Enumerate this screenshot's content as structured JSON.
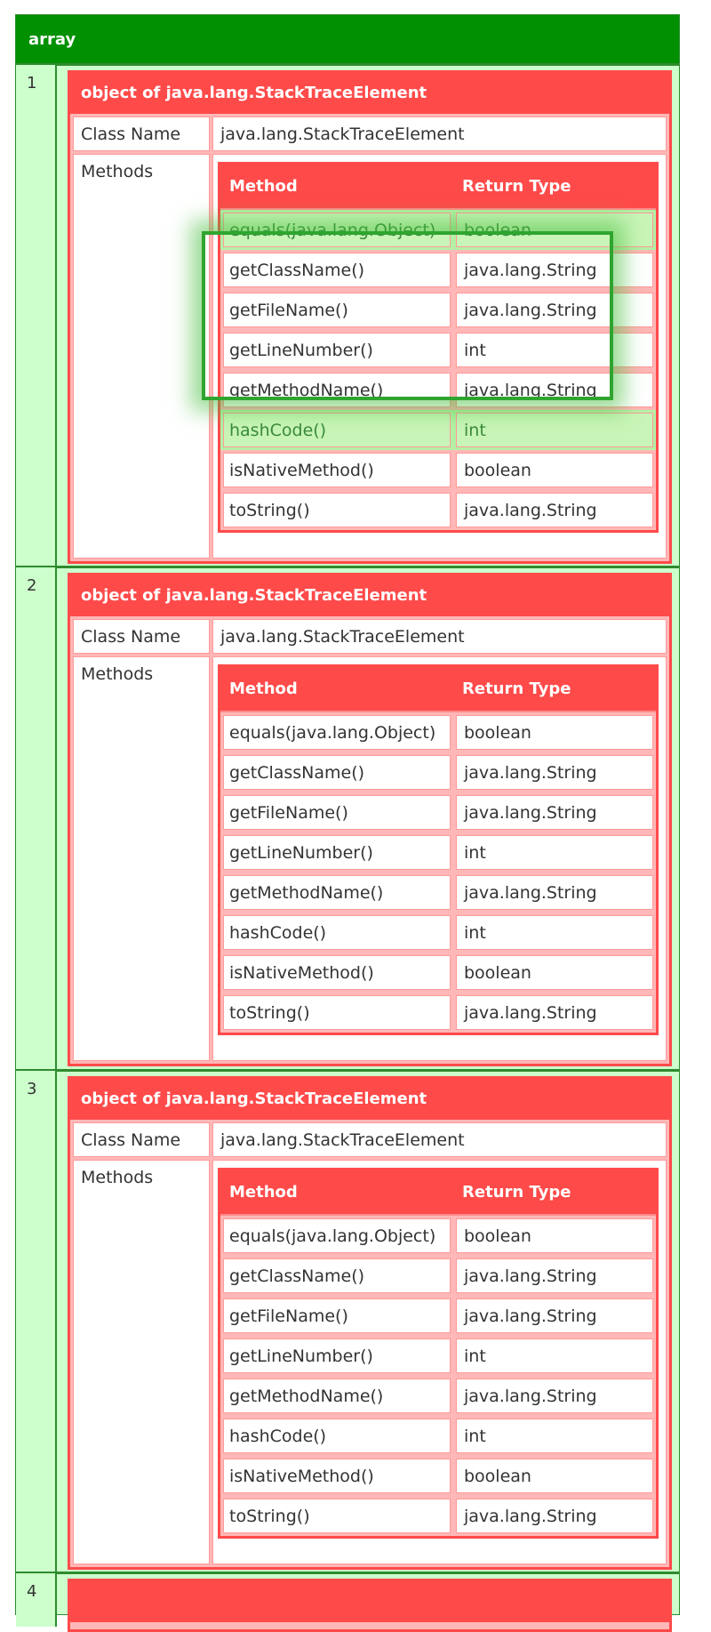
{
  "array": {
    "title": "array",
    "rows": [
      {
        "index": "1",
        "object": {
          "title": "object of java.lang.StackTraceElement",
          "class_name_label": "Class Name",
          "class_name_value": "java.lang.StackTraceElement",
          "methods_label": "Methods",
          "methods_header": {
            "method": "Method",
            "return_type": "Return Type"
          },
          "methods": [
            {
              "name": "equals(java.lang.Object)",
              "return_type": "boolean"
            },
            {
              "name": "getClassName()",
              "return_type": "java.lang.String"
            },
            {
              "name": "getFileName()",
              "return_type": "java.lang.String"
            },
            {
              "name": "getLineNumber()",
              "return_type": "int"
            },
            {
              "name": "getMethodName()",
              "return_type": "java.lang.String"
            },
            {
              "name": "hashCode()",
              "return_type": "int"
            },
            {
              "name": "isNativeMethod()",
              "return_type": "boolean"
            },
            {
              "name": "toString()",
              "return_type": "java.lang.String"
            }
          ]
        }
      },
      {
        "index": "2",
        "object": {
          "title": "object of java.lang.StackTraceElement",
          "class_name_label": "Class Name",
          "class_name_value": "java.lang.StackTraceElement",
          "methods_label": "Methods",
          "methods_header": {
            "method": "Method",
            "return_type": "Return Type"
          },
          "methods": [
            {
              "name": "equals(java.lang.Object)",
              "return_type": "boolean"
            },
            {
              "name": "getClassName()",
              "return_type": "java.lang.String"
            },
            {
              "name": "getFileName()",
              "return_type": "java.lang.String"
            },
            {
              "name": "getLineNumber()",
              "return_type": "int"
            },
            {
              "name": "getMethodName()",
              "return_type": "java.lang.String"
            },
            {
              "name": "hashCode()",
              "return_type": "int"
            },
            {
              "name": "isNativeMethod()",
              "return_type": "boolean"
            },
            {
              "name": "toString()",
              "return_type": "java.lang.String"
            }
          ]
        }
      },
      {
        "index": "3",
        "object": {
          "title": "object of java.lang.StackTraceElement",
          "class_name_label": "Class Name",
          "class_name_value": "java.lang.StackTraceElement",
          "methods_label": "Methods",
          "methods_header": {
            "method": "Method",
            "return_type": "Return Type"
          },
          "methods": [
            {
              "name": "equals(java.lang.Object)",
              "return_type": "boolean"
            },
            {
              "name": "getClassName()",
              "return_type": "java.lang.String"
            },
            {
              "name": "getFileName()",
              "return_type": "java.lang.String"
            },
            {
              "name": "getLineNumber()",
              "return_type": "int"
            },
            {
              "name": "getMethodName()",
              "return_type": "java.lang.String"
            },
            {
              "name": "hashCode()",
              "return_type": "int"
            },
            {
              "name": "isNativeMethod()",
              "return_type": "boolean"
            },
            {
              "name": "toString()",
              "return_type": "java.lang.String"
            }
          ]
        }
      },
      {
        "index": "4"
      }
    ]
  },
  "colors": {
    "array_header": "#009000",
    "array_bg": "#ccffcc",
    "object_header": "#ff4a4a",
    "object_bg": "#ffb7b7",
    "highlight": "#2fa52f"
  }
}
